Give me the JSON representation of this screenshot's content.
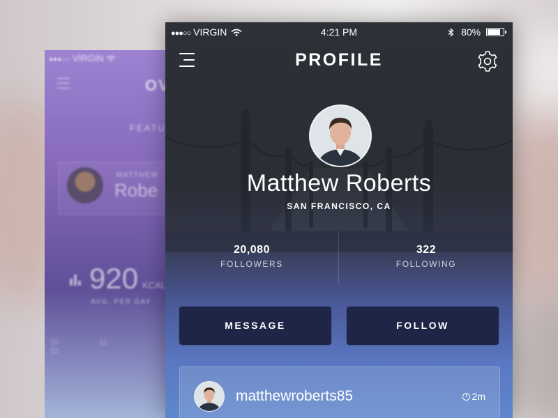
{
  "back_screen": {
    "carrier": "VIRGIN",
    "title": "OV",
    "section": "FEATU",
    "user_small": "MATTHEW",
    "user_name": "Robe",
    "metric_value": "920",
    "metric_unit": "KCAL",
    "metric_label": "AVG. PER DAY",
    "days": [
      "20",
      "21",
      "22"
    ]
  },
  "status_bar": {
    "carrier": "VIRGIN",
    "time": "4:21 PM",
    "battery": "80%"
  },
  "header": {
    "title": "PROFILE"
  },
  "profile": {
    "name": "Matthew Roberts",
    "location": "SAN FRANCISCO, CA"
  },
  "stats": {
    "followers_count": "20,080",
    "followers_label": "FOLLOWERS",
    "following_count": "322",
    "following_label": "FOLLOWING"
  },
  "actions": {
    "message_label": "MESSAGE",
    "follow_label": "FOLLOW"
  },
  "post": {
    "username": "matthewroberts85",
    "time": "2m"
  },
  "colors": {
    "button_bg": "#1f2546",
    "accent_blue": "#5f87cc"
  },
  "icons": [
    "menu-icon",
    "gear-icon",
    "wifi-icon",
    "bluetooth-icon",
    "battery-icon",
    "clock-icon",
    "bar-chart-icon"
  ]
}
